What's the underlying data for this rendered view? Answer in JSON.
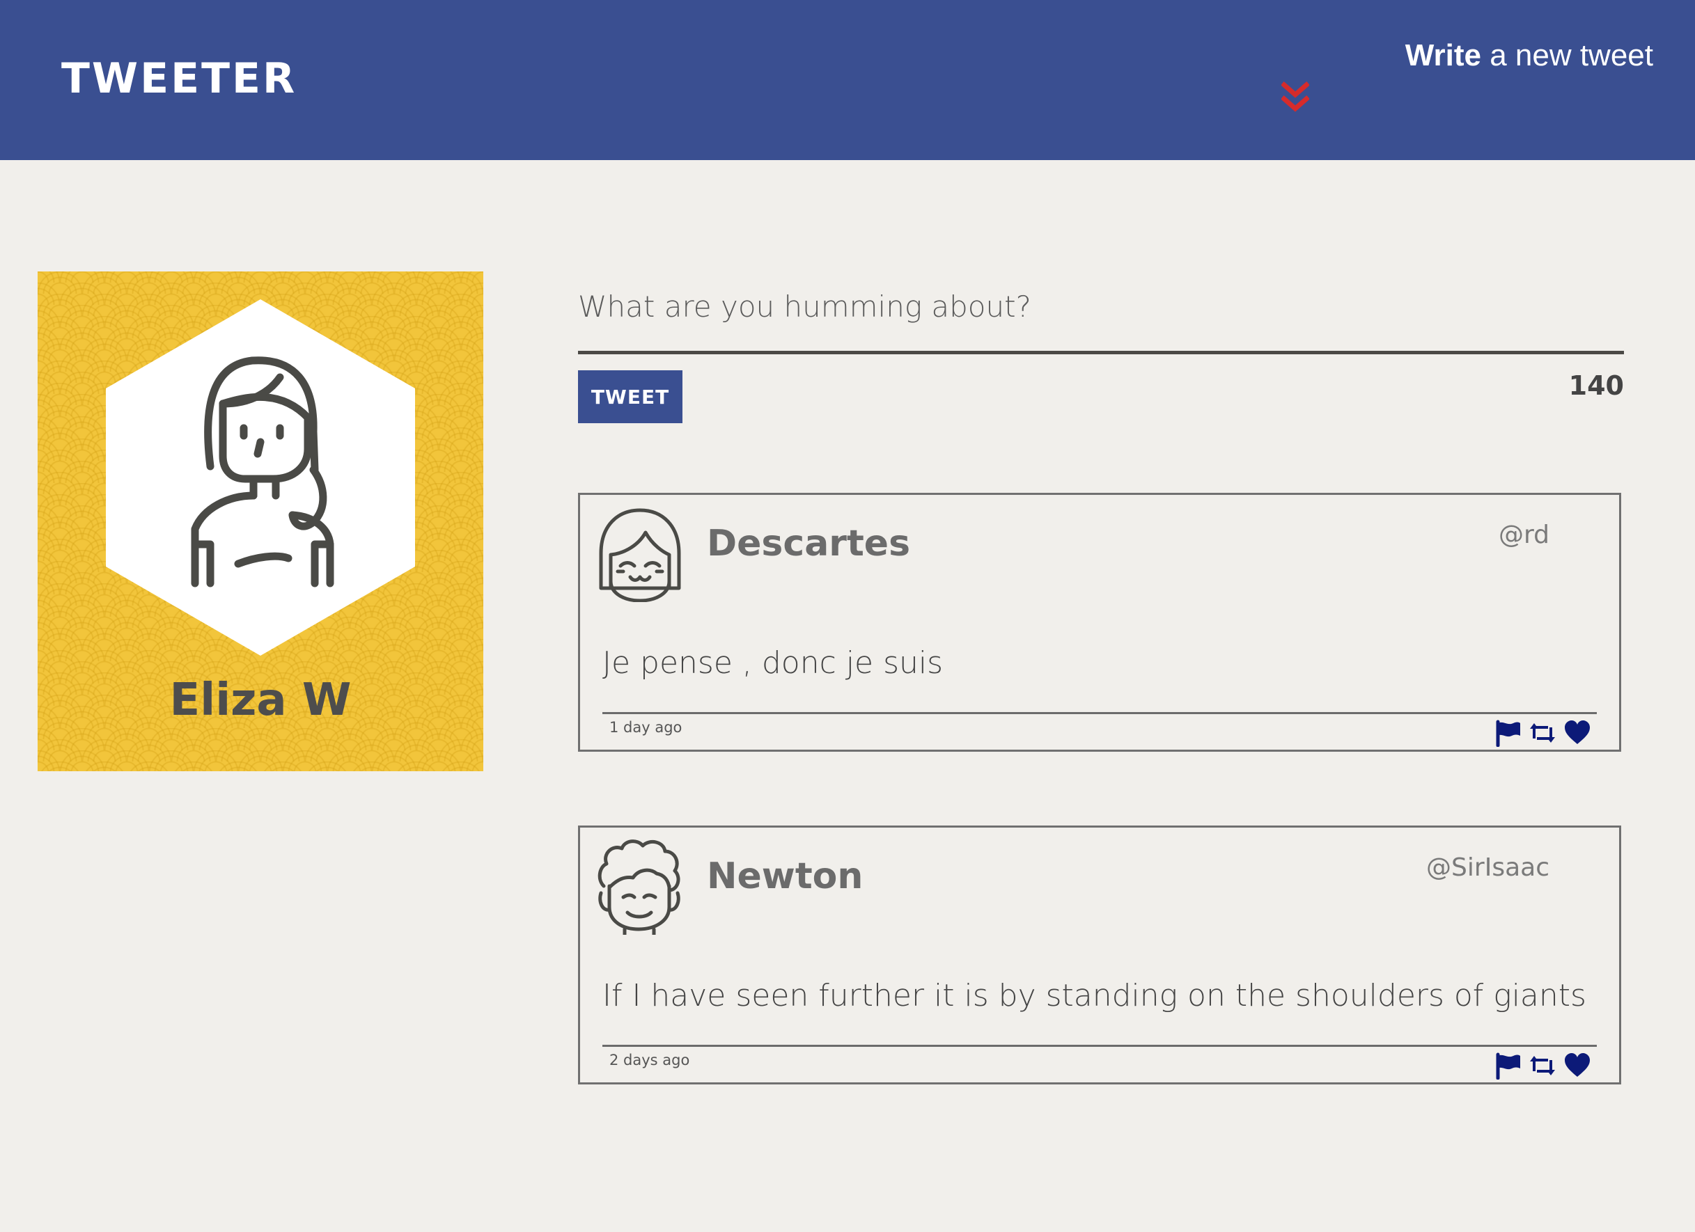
{
  "app": {
    "brand": "TWEETER"
  },
  "header": {
    "compose_strong": "Write",
    "compose_rest": " a new tweet",
    "compose_icon": "double-chevron-down-icon",
    "accent_color": "#d62b2b"
  },
  "profile": {
    "name": "Eliza W",
    "background_color": "#f2c53b",
    "avatar_icon": "woman-avatar-icon"
  },
  "composer": {
    "placeholder": "What are you humming about?",
    "value": "",
    "button_label": "TWEET",
    "char_count": "140"
  },
  "tweets": [
    {
      "author": "Descartes",
      "handle": "@rd",
      "body": "Je pense , donc je suis",
      "time": "1 day ago",
      "avatar_icon": "girl-avatar-icon"
    },
    {
      "author": "Newton",
      "handle": "@SirIsaac",
      "body": "If I have seen further it is by standing on the shoulders of giants",
      "time": "2 days ago",
      "avatar_icon": "curly-hair-avatar-icon"
    }
  ],
  "colors": {
    "header": "#3a4f91",
    "page_background": "#f1efeb",
    "action_icons": "#0c1a78"
  }
}
